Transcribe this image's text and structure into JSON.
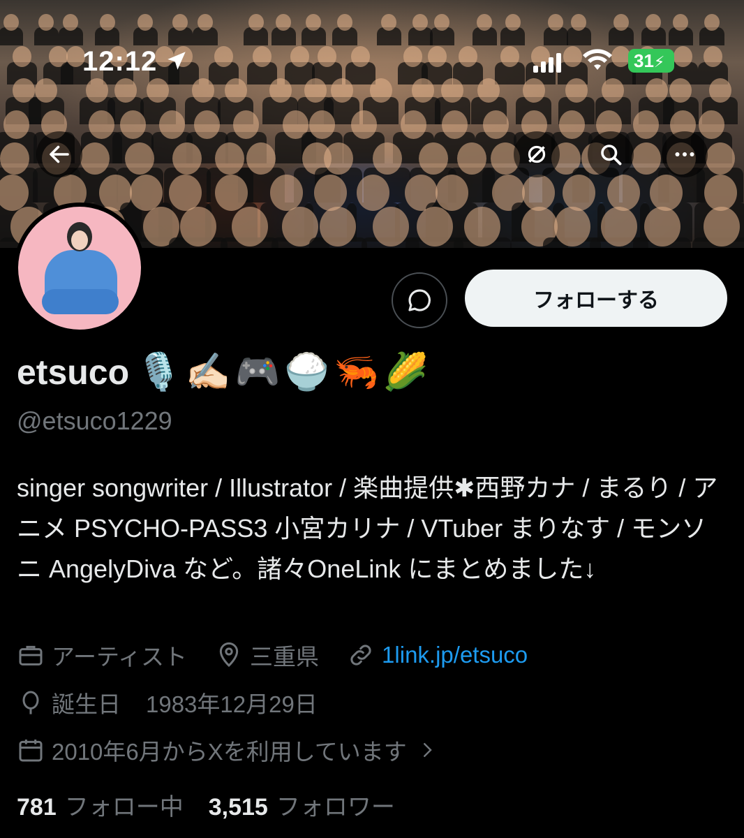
{
  "status_bar": {
    "time": "12:12",
    "battery": "31"
  },
  "profile": {
    "name": "etsuco",
    "name_emojis": "🎙️✍🏻🎮🍚🦐🌽",
    "handle": "@etsuco1229",
    "bio": "singer songwriter / Illustrator / 楽曲提供✱西野カナ / まるり / アニメ PSYCHO-PASS3 小宮カリナ / VTuber まりなす / モンソニ AngelyDiva など。諸々OneLink にまとめました↓",
    "category": "アーティスト",
    "location": "三重県",
    "link": "1link.jp/etsuco",
    "birthday_label": "誕生日",
    "birthday": "1983年12月29日",
    "joined": "2010年6月からXを利用しています",
    "following_count": "781",
    "following_label": "フォロー中",
    "followers_count": "3,515",
    "followers_label": "フォロワー"
  },
  "actions": {
    "follow_label": "フォローする"
  },
  "icons": [
    "back-arrow-icon",
    "grok-icon",
    "search-icon",
    "more-icon",
    "message-icon",
    "briefcase-icon",
    "location-pin-icon",
    "link-icon",
    "balloon-icon",
    "calendar-icon",
    "chevron-right-icon"
  ]
}
